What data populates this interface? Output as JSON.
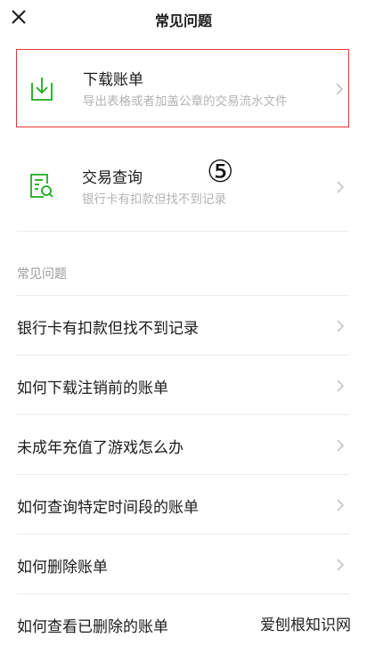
{
  "header": {
    "title": "常见问题"
  },
  "cards": [
    {
      "title": "下载账单",
      "subtitle": "导出表格或者加盖公章的交易流水文件"
    },
    {
      "title": "交易查询",
      "subtitle": "银行卡有扣款但找不到记录"
    }
  ],
  "annotation": "⑤",
  "section": {
    "title": "常见问题"
  },
  "faq": [
    "银行卡有扣款但找不到记录",
    "如何下载注销前的账单",
    "未成年充值了游戏怎么办",
    "如何查询特定时间段的账单",
    "如何删除账单",
    "如何查看已删除的账单"
  ],
  "watermark": "爱刨根知识网",
  "colors": {
    "accent_green": "#1aad19",
    "highlight_red": "#e53935"
  }
}
